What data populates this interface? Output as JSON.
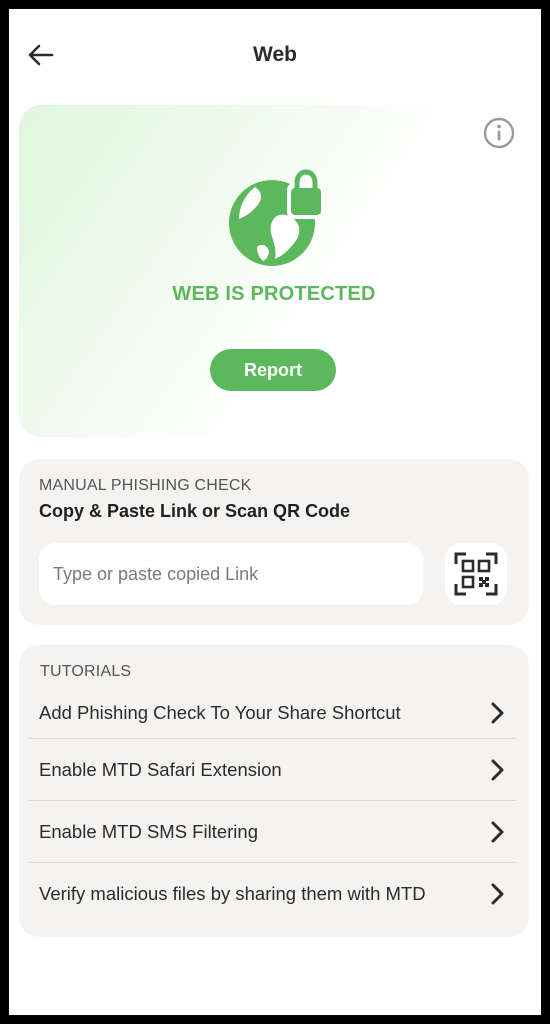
{
  "header": {
    "title": "Web",
    "back_icon": "back-arrow-icon"
  },
  "status": {
    "icon": "globe-lock-icon",
    "text": "WEB IS PROTECTED",
    "report_label": "Report",
    "info_icon": "info-icon",
    "color": "#5cb85c"
  },
  "manual_check": {
    "label": "MANUAL PHISHING CHECK",
    "subtitle": "Copy & Paste Link or Scan QR Code",
    "input_value": "",
    "input_placeholder": "Type or paste copied Link",
    "qr_icon": "qr-scan-icon"
  },
  "tutorials": {
    "label": "TUTORIALS",
    "items": [
      {
        "label": "Add Phishing Check To Your Share Shortcut"
      },
      {
        "label": "Enable MTD Safari Extension"
      },
      {
        "label": "Enable MTD SMS Filtering"
      },
      {
        "label": "Verify malicious files by sharing them with MTD"
      }
    ]
  }
}
